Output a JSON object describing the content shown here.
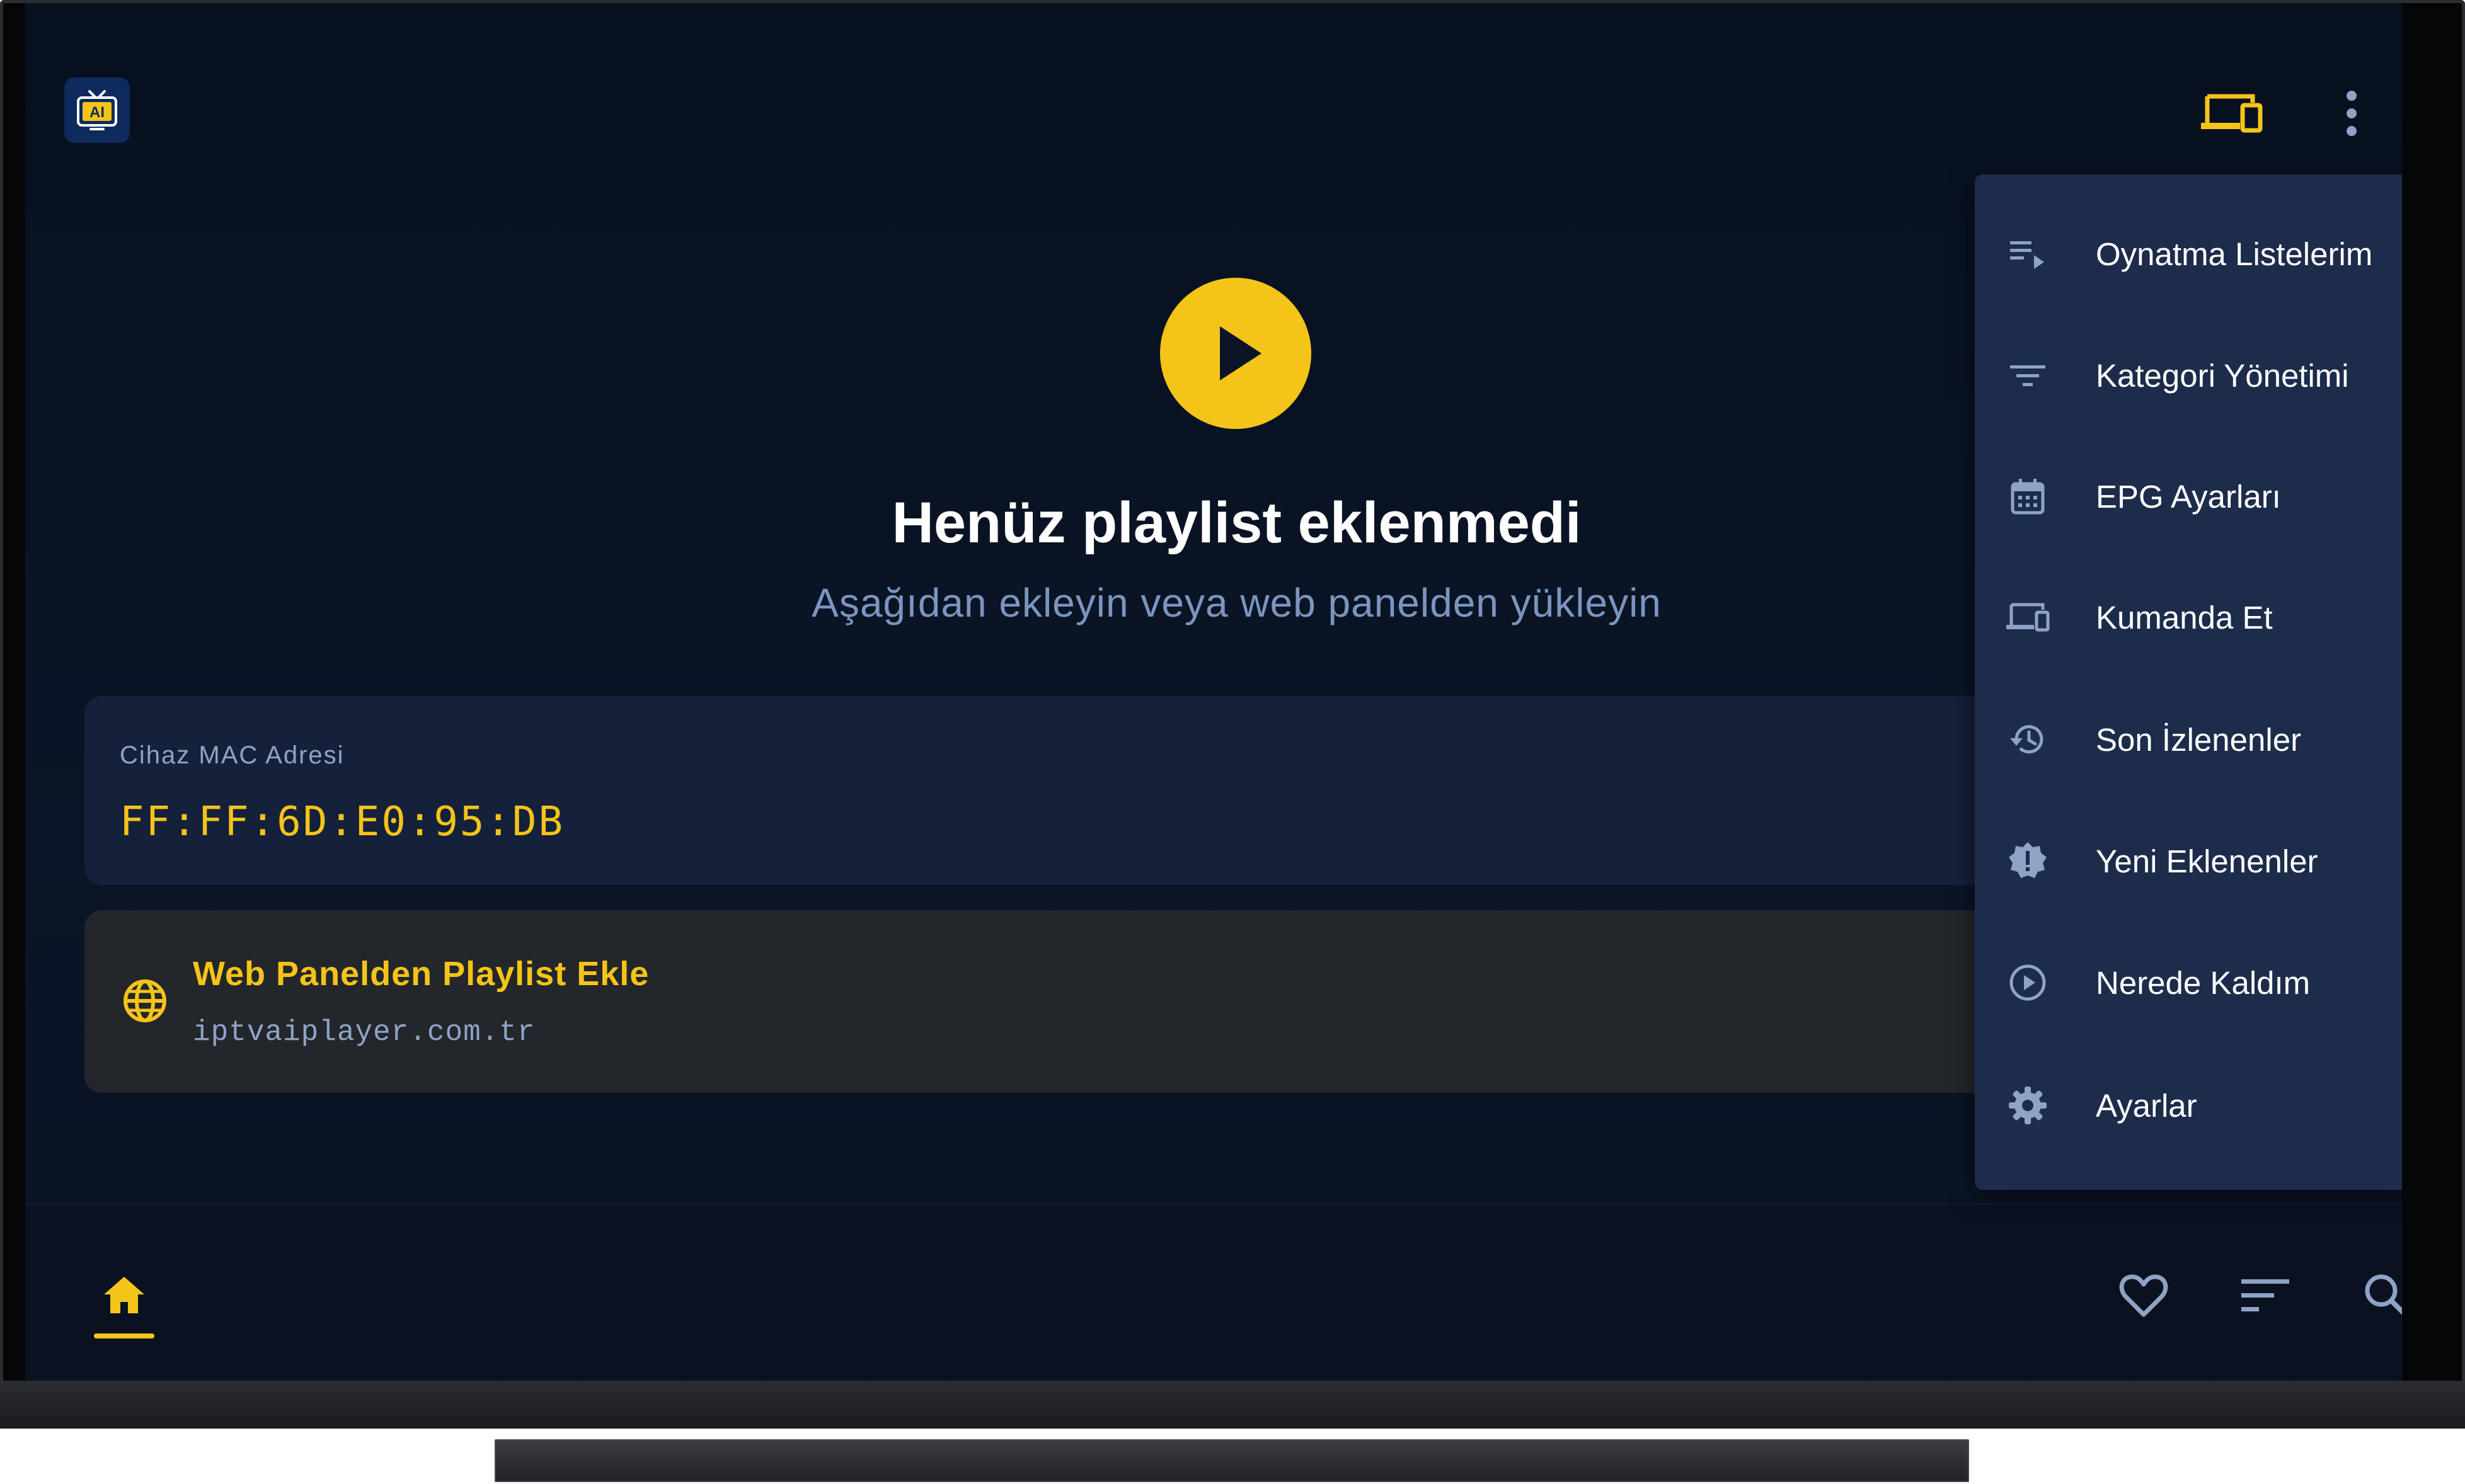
{
  "app": {
    "logo_text": "AI"
  },
  "hero": {
    "title": "Henüz playlist eklenmedi",
    "subtitle": "Aşağıdan ekleyin veya web panelden yükleyin"
  },
  "mac_card": {
    "label": "Cihaz MAC Adresi",
    "value": "FF:FF:6D:E0:95:DB"
  },
  "web_card": {
    "title": "Web Panelden Playlist Ekle",
    "url": "iptvaiplayer.com.tr"
  },
  "menu": {
    "items": [
      {
        "label": "Oynatma Listelerim",
        "icon": "playlist-play-icon"
      },
      {
        "label": "Kategori Yönetimi",
        "icon": "filter-list-icon"
      },
      {
        "label": "EPG Ayarları",
        "icon": "calendar-icon"
      },
      {
        "label": "Kumanda Et",
        "icon": "devices-icon"
      },
      {
        "label": "Son İzlenenler",
        "icon": "history-icon"
      },
      {
        "label": "Yeni Eklenenler",
        "icon": "new-badge-icon"
      },
      {
        "label": "Nerede Kaldım",
        "icon": "play-circle-icon"
      },
      {
        "label": "Ayarlar",
        "icon": "settings-gear-icon"
      }
    ]
  },
  "bottom_nav": {
    "active": "home",
    "items": [
      "home-icon",
      "favorite-heart-icon",
      "sort-icon",
      "search-icon"
    ]
  },
  "colors": {
    "accent": "#f4c419",
    "background": "#0a1324",
    "card": "#15213a",
    "menu": "#1d2c4b",
    "muted_text": "#8fa3c6"
  }
}
